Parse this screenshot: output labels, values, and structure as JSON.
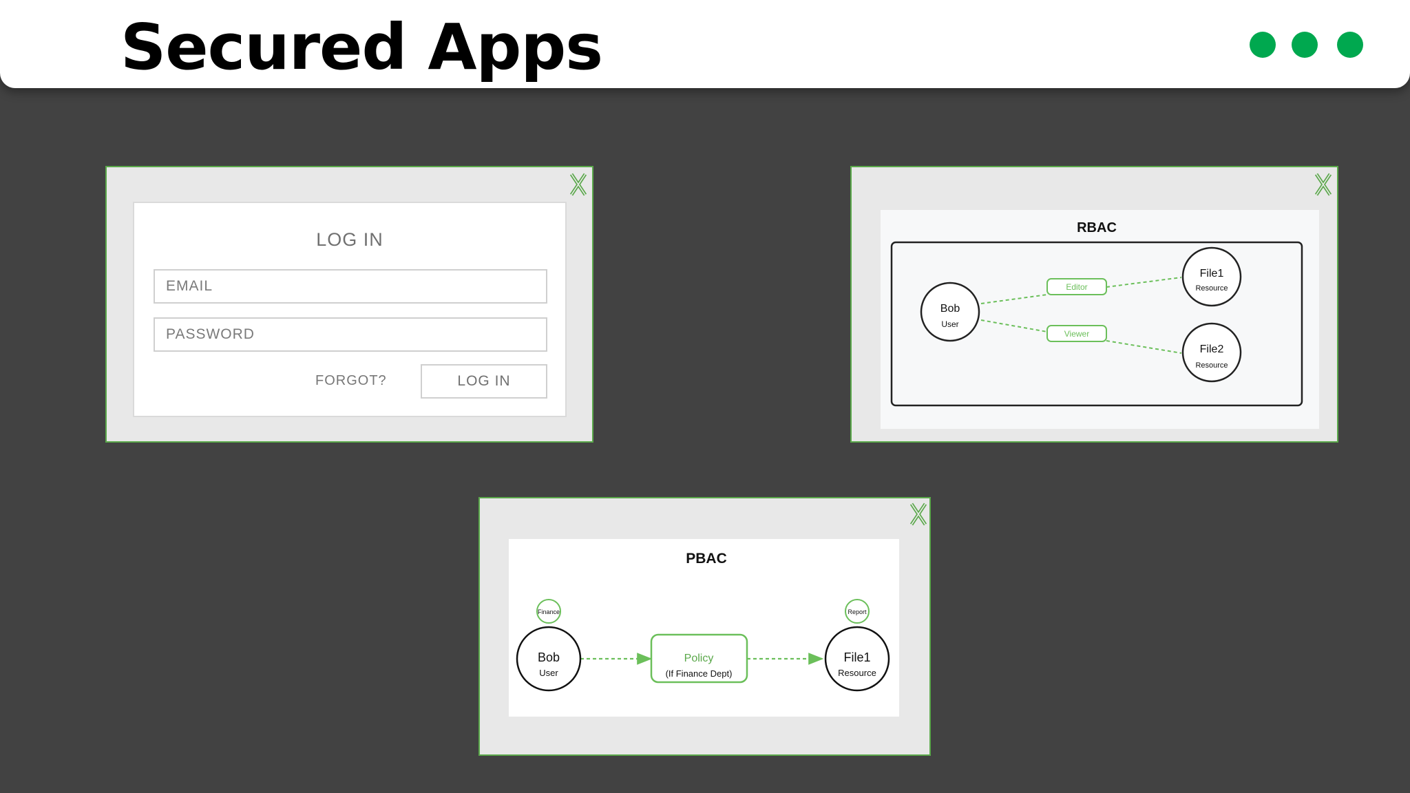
{
  "header": {
    "title": "Secured Apps",
    "window_dots": [
      "#00a84f",
      "#00a84f",
      "#00a84f"
    ]
  },
  "colors": {
    "background": "#424242",
    "accent_green": "#5aa84a",
    "panel_gray": "#e8e8e8"
  },
  "login_window": {
    "title": "LOG IN",
    "email_placeholder": "EMAIL",
    "password_placeholder": "PASSWORD",
    "forgot_label": "FORGOT?",
    "login_button": "LOG IN",
    "close_icon": "close-x-icon"
  },
  "rbac_window": {
    "title": "RBAC",
    "user": {
      "name": "Bob",
      "type": "User"
    },
    "roles": [
      "Editor",
      "Viewer"
    ],
    "resources": [
      {
        "name": "File1",
        "type": "Resource"
      },
      {
        "name": "File2",
        "type": "Resource"
      }
    ],
    "close_icon": "close-x-icon"
  },
  "pbac_window": {
    "title": "PBAC",
    "user": {
      "name": "Bob",
      "type": "User",
      "attribute": "Finance"
    },
    "policy": {
      "name": "Policy",
      "condition": "(If Finance Dept)"
    },
    "resource": {
      "name": "File1",
      "type": "Resource",
      "attribute": "Report"
    },
    "close_icon": "close-x-icon"
  }
}
